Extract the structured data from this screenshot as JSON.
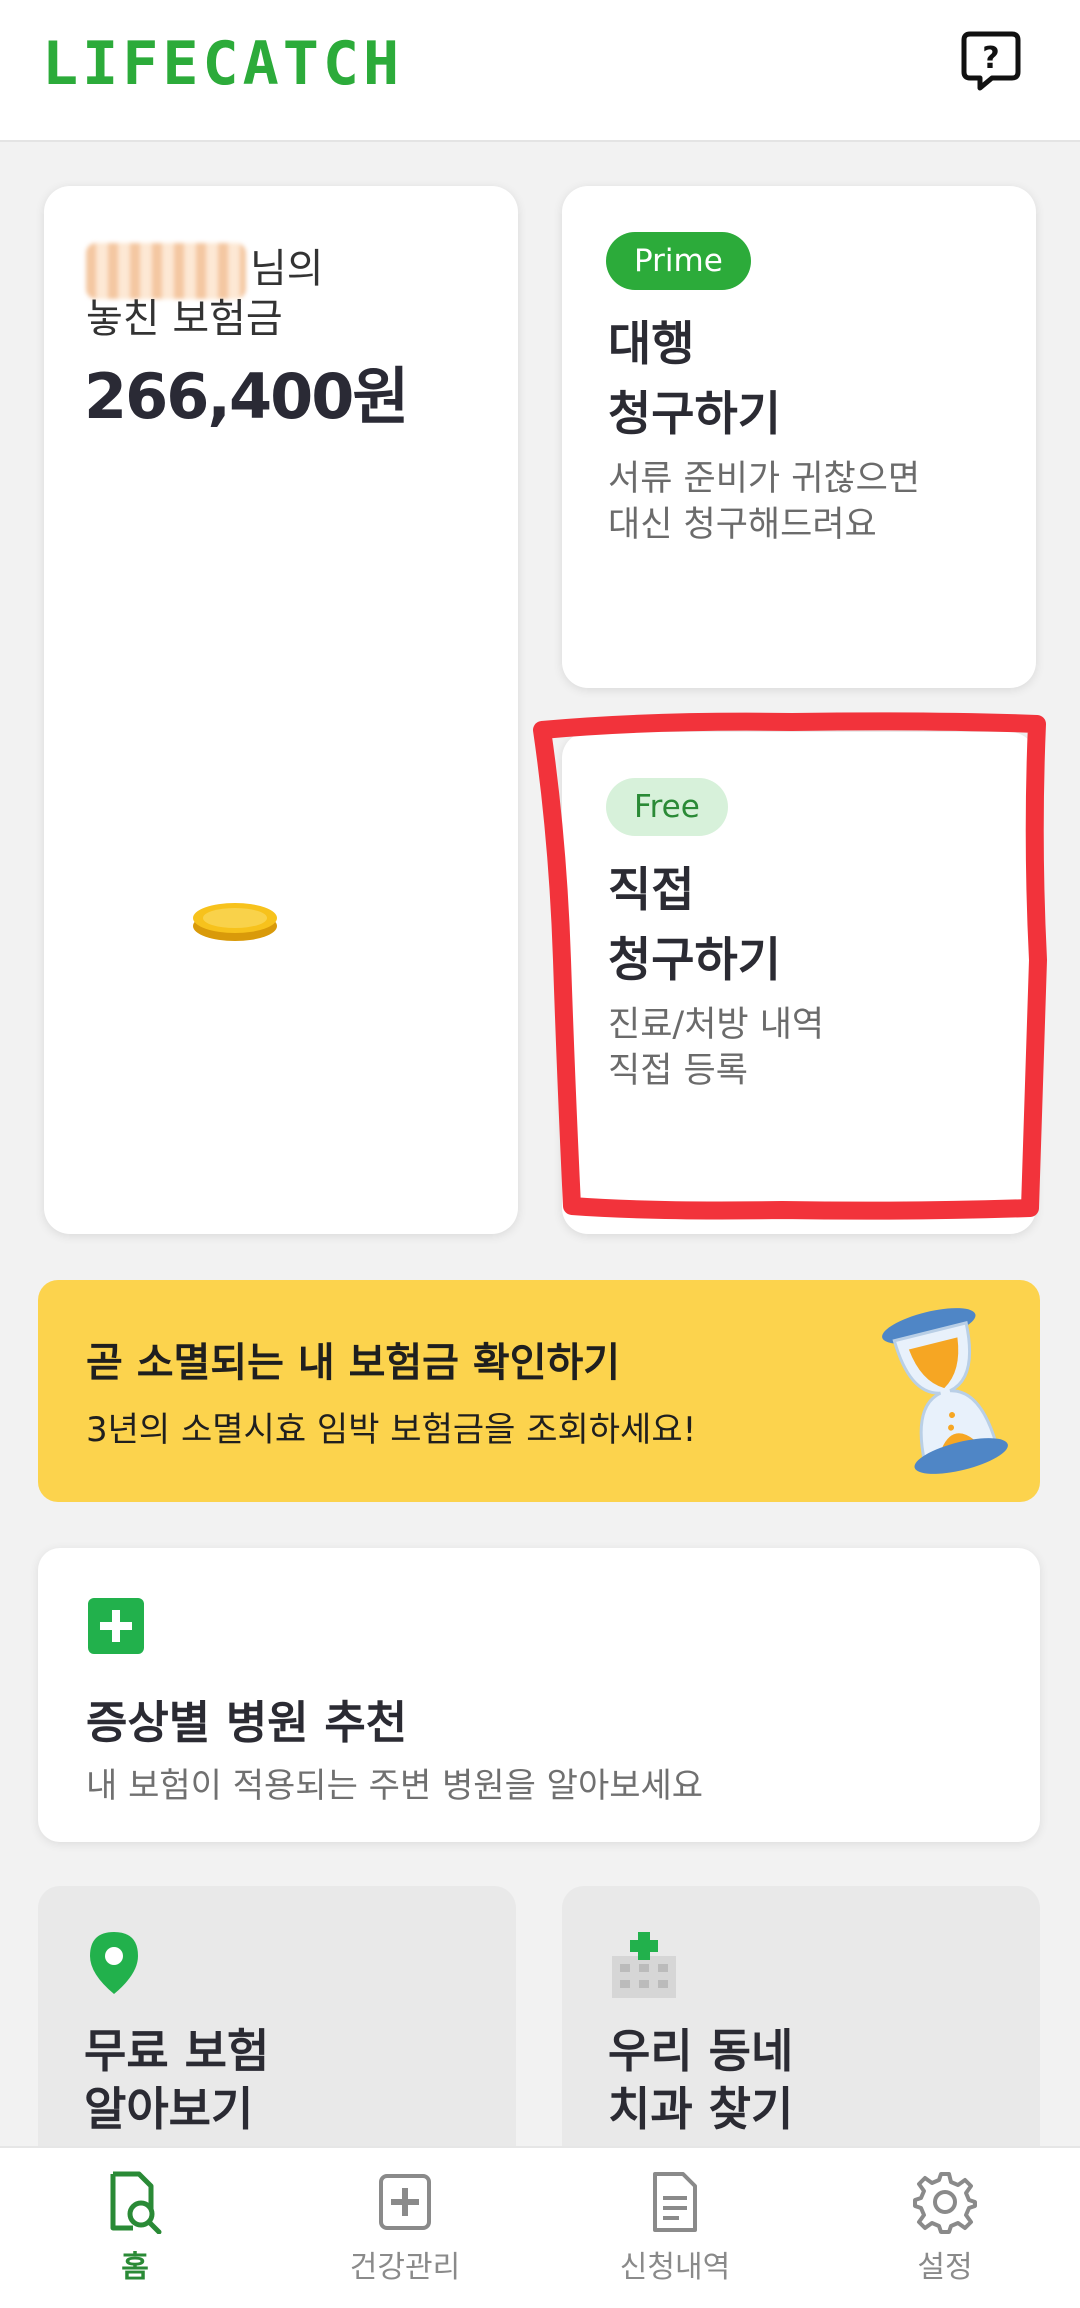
{
  "app": {
    "logo_text": "LIFECATCH",
    "brand_color": "#2cab3a",
    "help_icon": "help-icon"
  },
  "summary_card": {
    "name_suffix": "님의",
    "missed_label": "놓친 보험금",
    "amount": "266,400원",
    "coin_icon": "coin-icon"
  },
  "prime_card": {
    "badge": "Prime",
    "title_line1": "대행",
    "title_line2": "청구하기",
    "desc_line1": "서류 준비가 귀찮으면",
    "desc_line2": "대신 청구해드려요"
  },
  "free_card": {
    "badge": "Free",
    "title_line1": "직접",
    "title_line2": "청구하기",
    "desc_line1": "진료/처방 내역",
    "desc_line2": "직접 등록"
  },
  "expiry_banner": {
    "title": "곧 소멸되는 내 보험금 확인하기",
    "subtitle": "3년의 소멸시효 임박 보험금을 조회하세요!",
    "icon": "hourglass-icon",
    "background": "#fcd34d"
  },
  "hospital_card": {
    "title": "증상별 병원 추천",
    "subtitle": "내 보험이 적용되는 주변 병원을 알아보세요",
    "icon": "plus-icon"
  },
  "tiles": [
    {
      "title_line1": "무료 보험",
      "title_line2": "알아보기",
      "icon": "map-pin-icon"
    },
    {
      "title_line1": "우리 동네",
      "title_line2": "치과 찾기",
      "icon": "clinic-icon"
    }
  ],
  "tabbar": {
    "items": [
      {
        "label": "홈",
        "icon": "home-search-icon",
        "active": true
      },
      {
        "label": "건강관리",
        "icon": "health-plus-icon",
        "active": false
      },
      {
        "label": "신청내역",
        "icon": "document-icon",
        "active": false
      },
      {
        "label": "설정",
        "icon": "gear-icon",
        "active": false
      }
    ]
  }
}
